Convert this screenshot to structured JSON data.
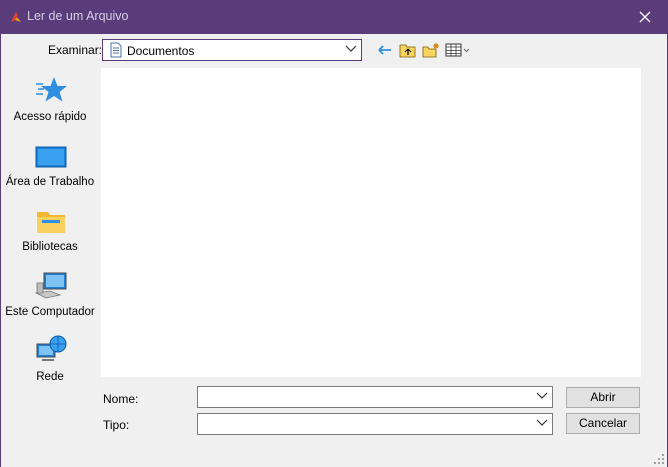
{
  "window": {
    "title": "Ler de um Arquivo"
  },
  "lookin": {
    "label": "Examinar:",
    "value": "Documentos"
  },
  "toolbar": {
    "icons": [
      "back-icon",
      "up-folder-icon",
      "new-folder-icon",
      "view-menu-icon"
    ]
  },
  "places": [
    {
      "label": "Acesso rápido",
      "icon": "star-icon"
    },
    {
      "label": "Área de Trabalho",
      "icon": "desktop-icon"
    },
    {
      "label": "Bibliotecas",
      "icon": "libraries-icon"
    },
    {
      "label": "Este Computador",
      "icon": "computer-icon"
    },
    {
      "label": "Rede",
      "icon": "network-icon"
    }
  ],
  "filename": {
    "label": "Nome:",
    "value": ""
  },
  "filetype": {
    "label": "Tipo:",
    "value": ""
  },
  "buttons": {
    "open": "Abrir",
    "cancel": "Cancelar"
  },
  "colors": {
    "titlebar": "#5b3c7a",
    "accent": "#2e8ee0"
  }
}
